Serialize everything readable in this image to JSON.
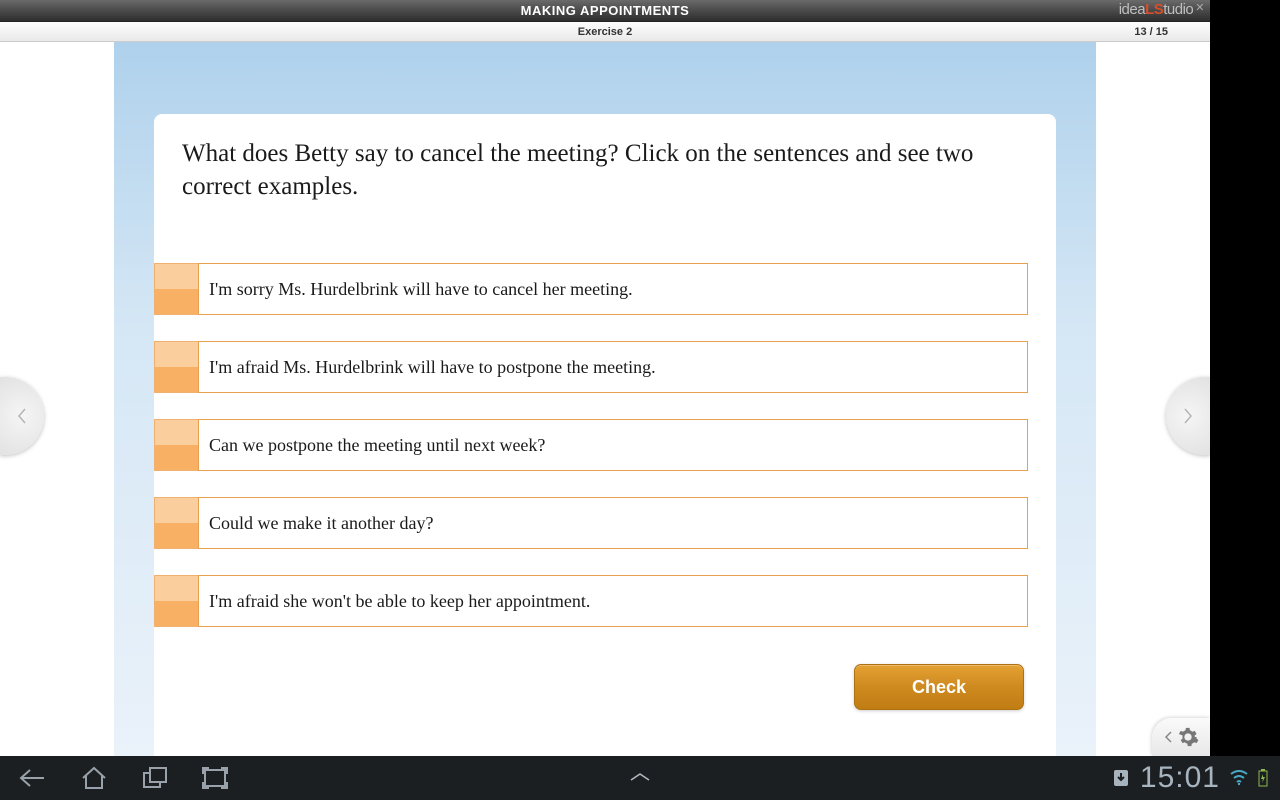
{
  "header": {
    "title": "MAKING APPOINTMENTS",
    "brand_prefix": "idea",
    "brand_mid": "LS",
    "brand_suffix": "tudio"
  },
  "subheader": {
    "exercise_label": "Exercise 2",
    "page_counter": "13 / 15"
  },
  "exercise": {
    "question": "What does Betty say to cancel the meeting? Click on the sentences and see two correct examples.",
    "options": [
      {
        "text": "I'm sorry Ms. Hurdelbrink will have to cancel her meeting."
      },
      {
        "text": "I'm afraid Ms. Hurdelbrink will have to postpone the meeting."
      },
      {
        "text": "Can we postpone the meeting until next week?"
      },
      {
        "text": "Could we make it another day?"
      },
      {
        "text": "I'm afraid she won't be able to keep her appointment."
      }
    ],
    "check_label": "Check"
  },
  "system": {
    "clock": "15:01"
  }
}
